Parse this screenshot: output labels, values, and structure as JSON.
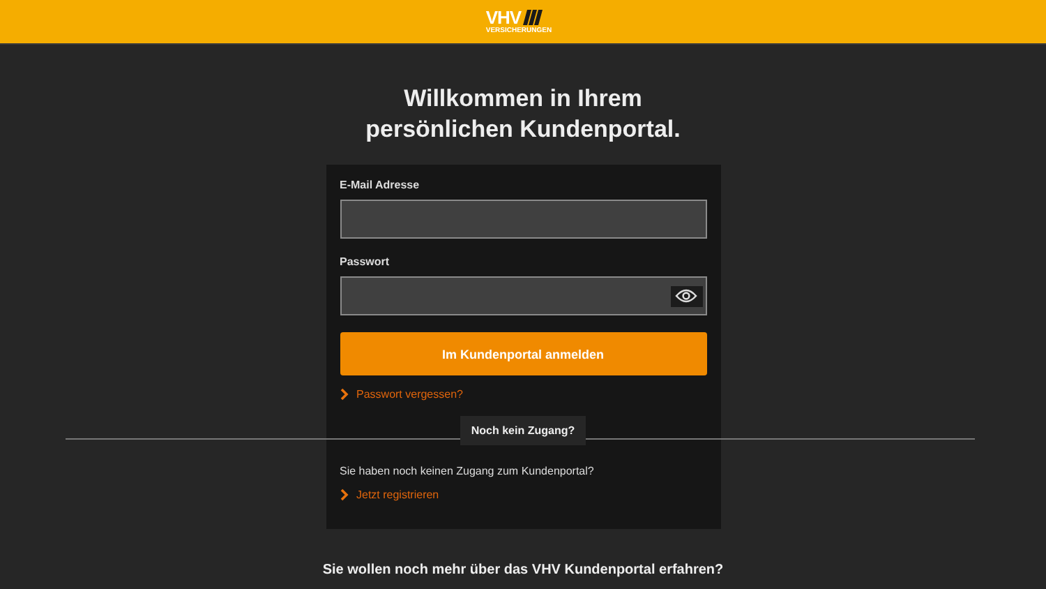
{
  "header": {
    "logo": {
      "name": "VHV",
      "subtitle": "VERSICHERUNGEN"
    }
  },
  "heading": [
    "Willkommen in Ihrem",
    "persönlichen Kundenportal."
  ],
  "login": {
    "email": {
      "label": "E-Mail Adresse"
    },
    "password": {
      "label": "Passwort"
    },
    "submit": "Im Kundenportal anmelden",
    "forgot_link": "Passwort vergessen?"
  },
  "divider_label": "Noch kein Zugang?",
  "register": {
    "text": "Sie haben noch keinen Zugang zum Kundenportal?",
    "link": "Jetzt registrieren"
  },
  "footer_heading": "Sie wollen noch mehr über das VHV Kundenportal erfahren?"
}
